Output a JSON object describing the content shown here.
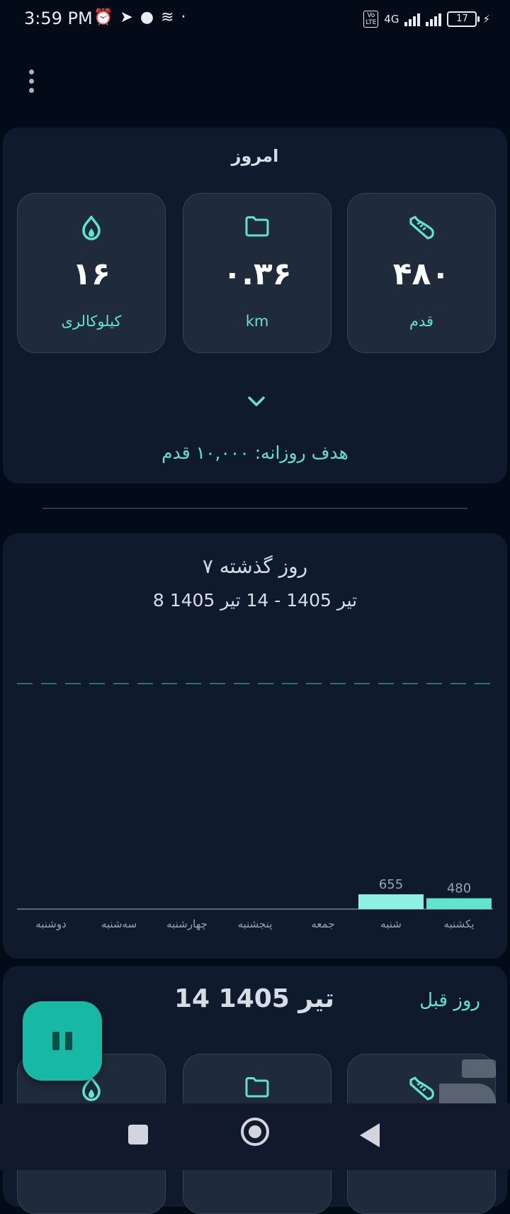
{
  "status_bar": {
    "time": "3:59 PM",
    "network": "4G",
    "volte_line1": "Vo",
    "volte_line2": "LTE",
    "battery": "17"
  },
  "today": {
    "title": "امروز",
    "calories": {
      "value": "۱۶",
      "label": "کیلوکالری",
      "icon": "flame-icon"
    },
    "distance": {
      "value": "۰.۳۶",
      "label": "km",
      "icon": "folder-icon"
    },
    "steps": {
      "value": "۴۸۰",
      "label": "قدم",
      "icon": "shoe-icon"
    },
    "goal": "هدف روزانه: ۱۰,۰۰۰ قدم"
  },
  "weekly": {
    "title": "۷ روز گذشته",
    "range": "8 تیر 1405 - 14 تیر 1405"
  },
  "chart_data": {
    "type": "bar",
    "categories": [
      "دوشنبه",
      "سه‌شنبه",
      "چهارشنبه",
      "پنجشنبه",
      "جمعه",
      "شنبه",
      "یکشنبه"
    ],
    "values": [
      0,
      0,
      0,
      0,
      0,
      655,
      480
    ],
    "data_labels": [
      "",
      "",
      "",
      "",
      "",
      "655",
      "480"
    ],
    "ylim": [
      0,
      10000
    ],
    "goal_line": 10000,
    "bar_colors": [
      "#8ef2e2",
      "#8ef2e2",
      "#8ef2e2",
      "#8ef2e2",
      "#8ef2e2",
      "#8ef2e2",
      "#5ee5cc"
    ]
  },
  "day_card": {
    "date": "14 تیر 1405",
    "prev_label": "روز قبل"
  },
  "colors": {
    "accent": "#5ee5cc",
    "background": "#040b18",
    "card": "#0f1a2c",
    "tile": "#1f2a3b",
    "fab": "#17b8a4"
  }
}
